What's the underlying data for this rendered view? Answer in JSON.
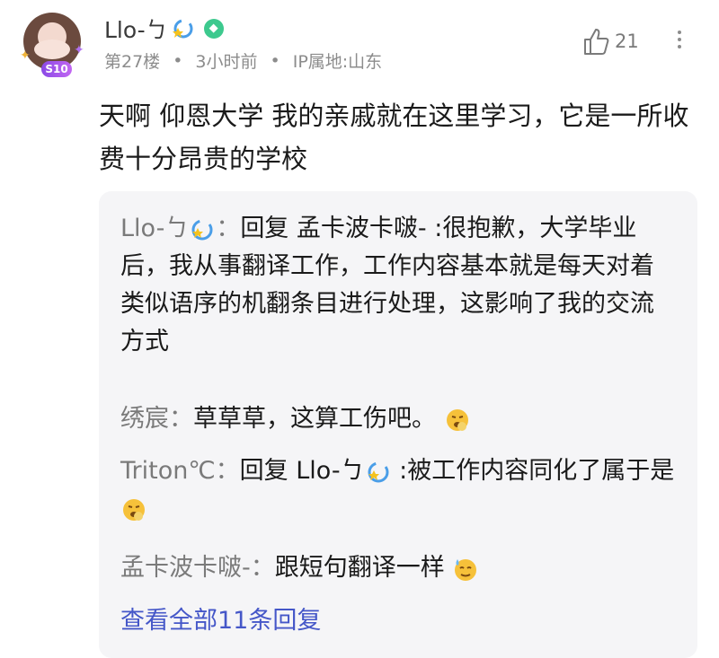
{
  "post": {
    "username": "Llo-ㄅ",
    "level_badge_icon": "diamond-badge-icon",
    "avatar_level": "S10",
    "floor": "第27楼",
    "time": "3小时前",
    "ip": "IP属地:山东",
    "likes": "21",
    "content": "天啊 仰恩大学 我的亲戚就在这里学习，它是一所收费十分昂贵的学校"
  },
  "replies": [
    {
      "name": "Llo-ㄅ",
      "name_suffix": "：",
      "text": "回复 孟卡波卡啵- :很抱歉，大学毕业后，我从事翻译工作，工作内容基本就是每天对着类似语序的机翻条目进行处理，这影响了我的交流方式"
    },
    {
      "name": "绣宸",
      "name_suffix": "：",
      "text": "草草草，这算工伤吧。"
    },
    {
      "name": "Triton℃",
      "name_suffix": "：",
      "text_prefix": "回复 Llo-ㄅ",
      "text": " :被工作内容同化了属于是"
    },
    {
      "name": "孟卡波卡啵-",
      "name_suffix": "：",
      "text": "跟短句翻译一样"
    }
  ],
  "view_all": "查看全部11条回复",
  "colors": {
    "accent": "#4557c8",
    "meta": "#8c8c8c",
    "reply_bg": "#f5f5f7",
    "badge": "#3dc98e"
  }
}
